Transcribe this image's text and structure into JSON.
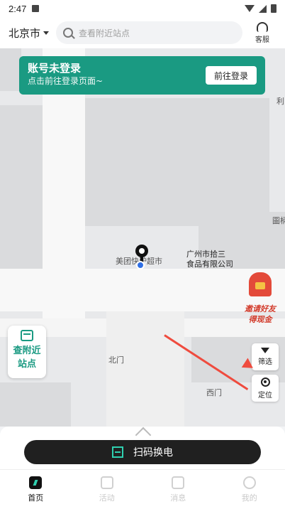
{
  "status_bar": {
    "time": "2:47"
  },
  "header": {
    "city": "北京市",
    "search_placeholder": "查看附近站点",
    "service_label": "客服"
  },
  "login_banner": {
    "title": "账号未登录",
    "subtitle": "点击前往登录页面~",
    "button_label": "前往登录"
  },
  "map": {
    "labels": {
      "supermarket": "美团快驴超市",
      "company_line1": "广州市拾三",
      "company_line2": "食品有限公司",
      "north_gate": "北门",
      "west_gate": "西门",
      "edge_top": "利",
      "edge_mid": "圖柄"
    }
  },
  "invite": {
    "line1": "邀请好友",
    "line2": "得现金"
  },
  "nearby_button": {
    "line1": "查附近",
    "line2": "站点"
  },
  "side_buttons": {
    "filter": "筛选",
    "locate": "定位"
  },
  "scan_button": "扫码换电",
  "tabbar": {
    "items": [
      {
        "label": "首页",
        "active": true
      },
      {
        "label": "活动",
        "active": false
      },
      {
        "label": "消息",
        "active": false
      },
      {
        "label": "我的",
        "active": false
      }
    ]
  },
  "colors": {
    "accent": "#1a9a82",
    "arrow": "#ef4b3e",
    "scan_bar": "#202020"
  }
}
